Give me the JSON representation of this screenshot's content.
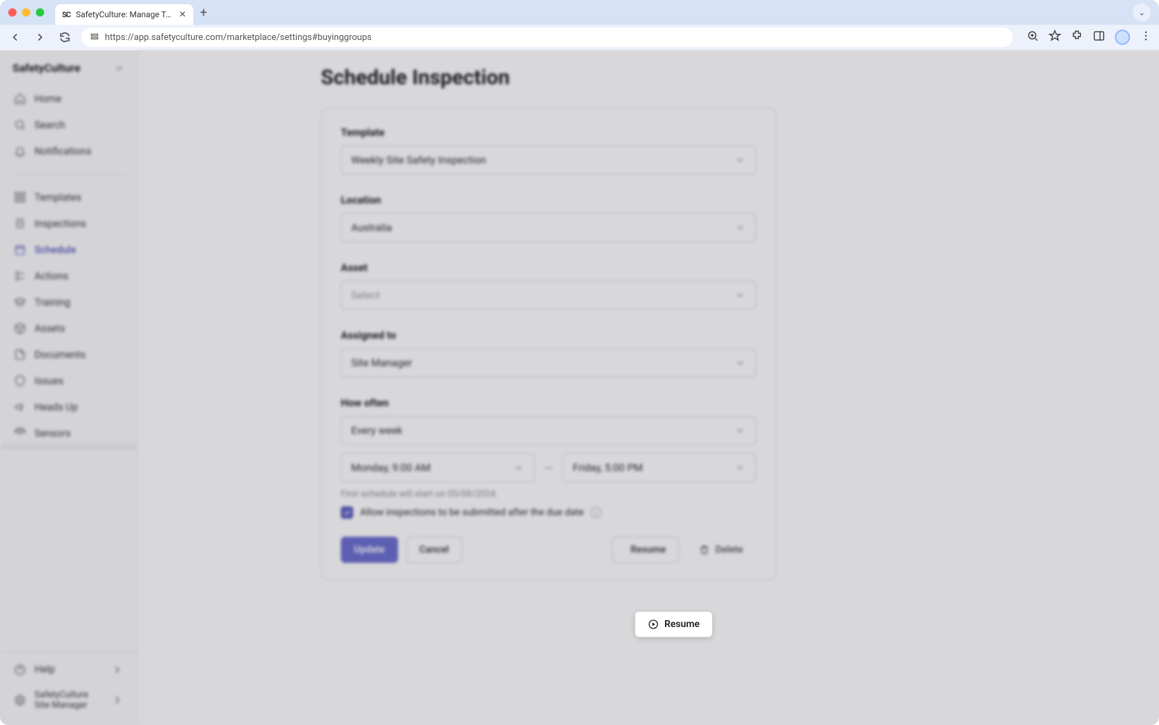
{
  "browser": {
    "tab_title": "SafetyCulture: Manage Teams and...",
    "url": "https://app.safetyculture.com/marketplace/settings#buyinggroups"
  },
  "sidebar": {
    "org_name": "SafetyCulture",
    "primary": [
      {
        "label": "Home"
      },
      {
        "label": "Search"
      },
      {
        "label": "Notifications"
      }
    ],
    "items": [
      {
        "label": "Templates"
      },
      {
        "label": "Inspections"
      },
      {
        "label": "Schedule"
      },
      {
        "label": "Actions"
      },
      {
        "label": "Training"
      },
      {
        "label": "Assets"
      },
      {
        "label": "Documents"
      },
      {
        "label": "Issues"
      },
      {
        "label": "Heads Up"
      },
      {
        "label": "Sensors"
      }
    ],
    "footer": {
      "help": "Help",
      "profile_line1": "SafetyCulture",
      "profile_line2": "Site Manager"
    }
  },
  "page": {
    "title": "Schedule Inspection",
    "fields": {
      "template": {
        "label": "Template",
        "value": "Weekly Site Safety Inspection"
      },
      "location": {
        "label": "Location",
        "value": "Australia"
      },
      "asset": {
        "label": "Asset",
        "placeholder": "Select"
      },
      "assigned": {
        "label": "Assigned to",
        "value": "Site Manager"
      },
      "howoften": {
        "label": "How often",
        "value": "Every week",
        "start": "Monday, 9:00 AM",
        "end": "Friday, 5:00 PM",
        "hint": "First schedule will start on 05/08/2024.",
        "checkbox_label": "Allow inspections to be submitted after the due date"
      }
    },
    "buttons": {
      "update": "Update",
      "cancel": "Cancel",
      "resume": "Resume",
      "delete": "Delete"
    }
  }
}
